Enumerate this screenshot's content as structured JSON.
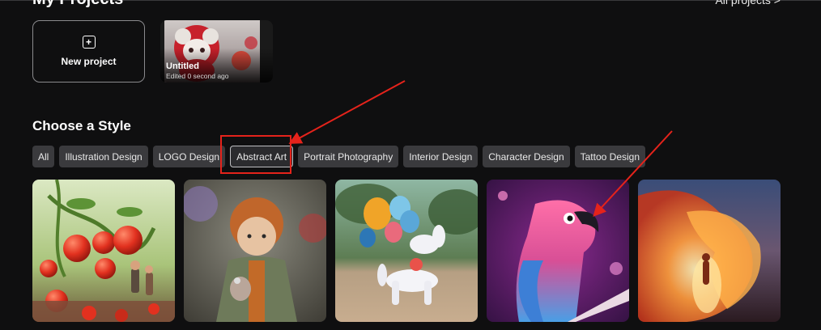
{
  "projects": {
    "title": "My Projects",
    "all_link": "All projects >",
    "new_label": "New project",
    "items": [
      {
        "name": "Untitled",
        "meta": "Edited 0 second ago"
      }
    ]
  },
  "styles": {
    "title": "Choose a Style",
    "chips": [
      "All",
      "Illustration Design",
      "LOGO Design",
      "Abstract Art",
      "Portrait Photography",
      "Interior Design",
      "Character Design",
      "Tattoo Design"
    ],
    "active": "Abstract Art"
  },
  "gallery": {
    "tiles": [
      "tomato-garden-image",
      "knitted-doll-image",
      "balloon-dog-image",
      "neon-parrot-image",
      "flame-figure-image"
    ]
  },
  "annotations": {
    "highlight_color": "#e5231b"
  }
}
